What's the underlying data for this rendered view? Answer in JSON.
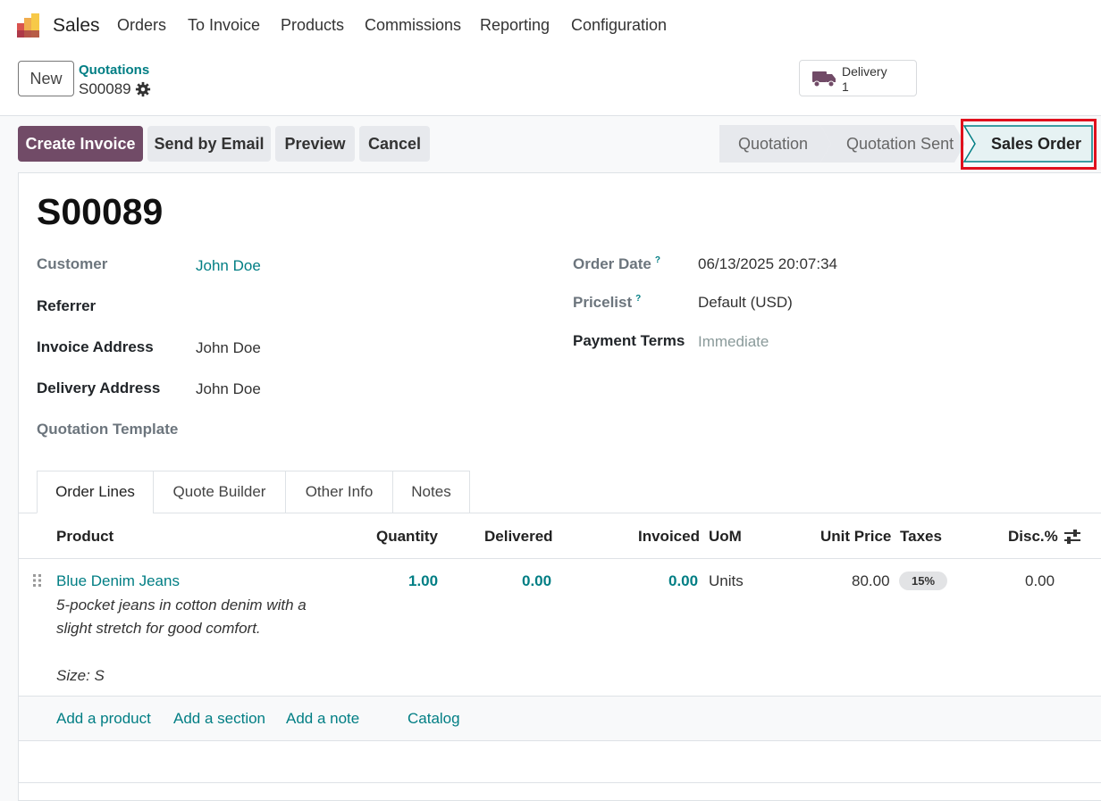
{
  "app": {
    "name": "Sales"
  },
  "menu": [
    "Orders",
    "To Invoice",
    "Products",
    "Commissions",
    "Reporting",
    "Configuration"
  ],
  "control": {
    "new_label": "New",
    "breadcrumb_parent": "Quotations",
    "breadcrumb_current": "S00089",
    "smart_button": {
      "label": "Delivery",
      "value": "1"
    }
  },
  "actions": {
    "create_invoice": "Create Invoice",
    "send_email": "Send by Email",
    "preview": "Preview",
    "cancel": "Cancel"
  },
  "statusbar": {
    "steps": [
      "Quotation",
      "Quotation Sent",
      "Sales Order"
    ],
    "active": "Sales Order"
  },
  "form": {
    "title": "S00089",
    "left": [
      {
        "label": "Customer",
        "value": "John Doe"
      },
      {
        "label": "Referrer",
        "value": ""
      },
      {
        "label": "Invoice Address",
        "value": "John Doe"
      },
      {
        "label": "Delivery Address",
        "value": "John Doe"
      },
      {
        "label": "Quotation Template",
        "value": ""
      }
    ],
    "right": [
      {
        "label": "Order Date",
        "value": "06/13/2025 20:07:34"
      },
      {
        "label": "Pricelist",
        "value": "Default (USD)"
      },
      {
        "label": "Payment Terms",
        "value": "Immediate"
      }
    ],
    "tooltip_mark": "?"
  },
  "tabs": [
    "Order Lines",
    "Quote Builder",
    "Other Info",
    "Notes"
  ],
  "table": {
    "headers": {
      "product": "Product",
      "quantity": "Quantity",
      "delivered": "Delivered",
      "invoiced": "Invoiced",
      "uom": "UoM",
      "unit_price": "Unit Price",
      "taxes": "Taxes",
      "disc": "Disc.%"
    },
    "rows": [
      {
        "product": "Blue Denim Jeans",
        "desc1": "5-pocket jeans in cotton denim with a",
        "desc2": "slight stretch for good comfort.",
        "desc3": "Size: S",
        "quantity": "1.00",
        "delivered": "0.00",
        "invoiced": "0.00",
        "uom": "Units",
        "unit_price": "80.00",
        "tax": "15%",
        "disc": "0.00"
      }
    ],
    "add_links": {
      "product": "Add a product",
      "section": "Add a section",
      "note": "Add a note",
      "catalog": "Catalog"
    }
  },
  "colors": {
    "brand": "#714b67",
    "link": "#017e84",
    "highlight": "#e0101d"
  }
}
